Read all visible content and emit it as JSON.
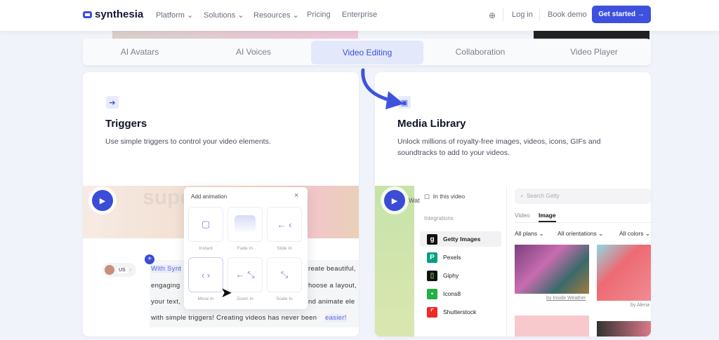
{
  "nav": {
    "brand": "synthesia",
    "links": [
      "Platform",
      "Solutions",
      "Resources",
      "Pricing",
      "Enterprise"
    ],
    "login": "Log in",
    "demo": "Book demo",
    "cta": "Get started →"
  },
  "tabs": [
    {
      "label": "AI Avatars"
    },
    {
      "label": "AI Voices"
    },
    {
      "label": "Video Editing",
      "active": true
    },
    {
      "label": "Collaboration"
    },
    {
      "label": "Video Player"
    }
  ],
  "left": {
    "title": "Triggers",
    "desc": "Use simple triggers to control your video elements.",
    "bg_word": "supe",
    "lang": "US",
    "popup": {
      "title": "Add animation",
      "items": [
        "Instant",
        "Fade In",
        "Slide In",
        "Move In",
        "Zoom In",
        "Scale In"
      ]
    },
    "script_lines": [
      "With Synt",
      "reate beautiful,",
      "engaging",
      "hoose a layout,",
      "your text,",
      "nd animate ele",
      "with simple triggers! Creating videos has never been",
      "easier!"
    ]
  },
  "right": {
    "title": "Media Library",
    "desc": "Unlock millions of royalty-free images, videos, icons, GIFs and soundtracks to add to your videos.",
    "watch": "Wat",
    "in_video": "In this video",
    "integrations_label": "Integrations",
    "integrations": [
      {
        "name": "Getty Images",
        "color": "#111111",
        "glyph": "g"
      },
      {
        "name": "Pexels",
        "color": "#05a081",
        "glyph": "P"
      },
      {
        "name": "Giphy",
        "color": "#111111",
        "glyph": "▯"
      },
      {
        "name": "Icons8",
        "color": "#1fb141",
        "glyph": "▪"
      },
      {
        "name": "Shutterstock",
        "color": "#ee2b24",
        "glyph": "⌜"
      }
    ],
    "search_placeholder": "Search Getty",
    "media_tabs": [
      "Video",
      "Image"
    ],
    "filters": [
      "All plans",
      "All orientations",
      "All colors"
    ],
    "credit1": "by Inside Weather",
    "credit2": "by Alena"
  },
  "colors": {
    "accent": "#3d50de"
  }
}
